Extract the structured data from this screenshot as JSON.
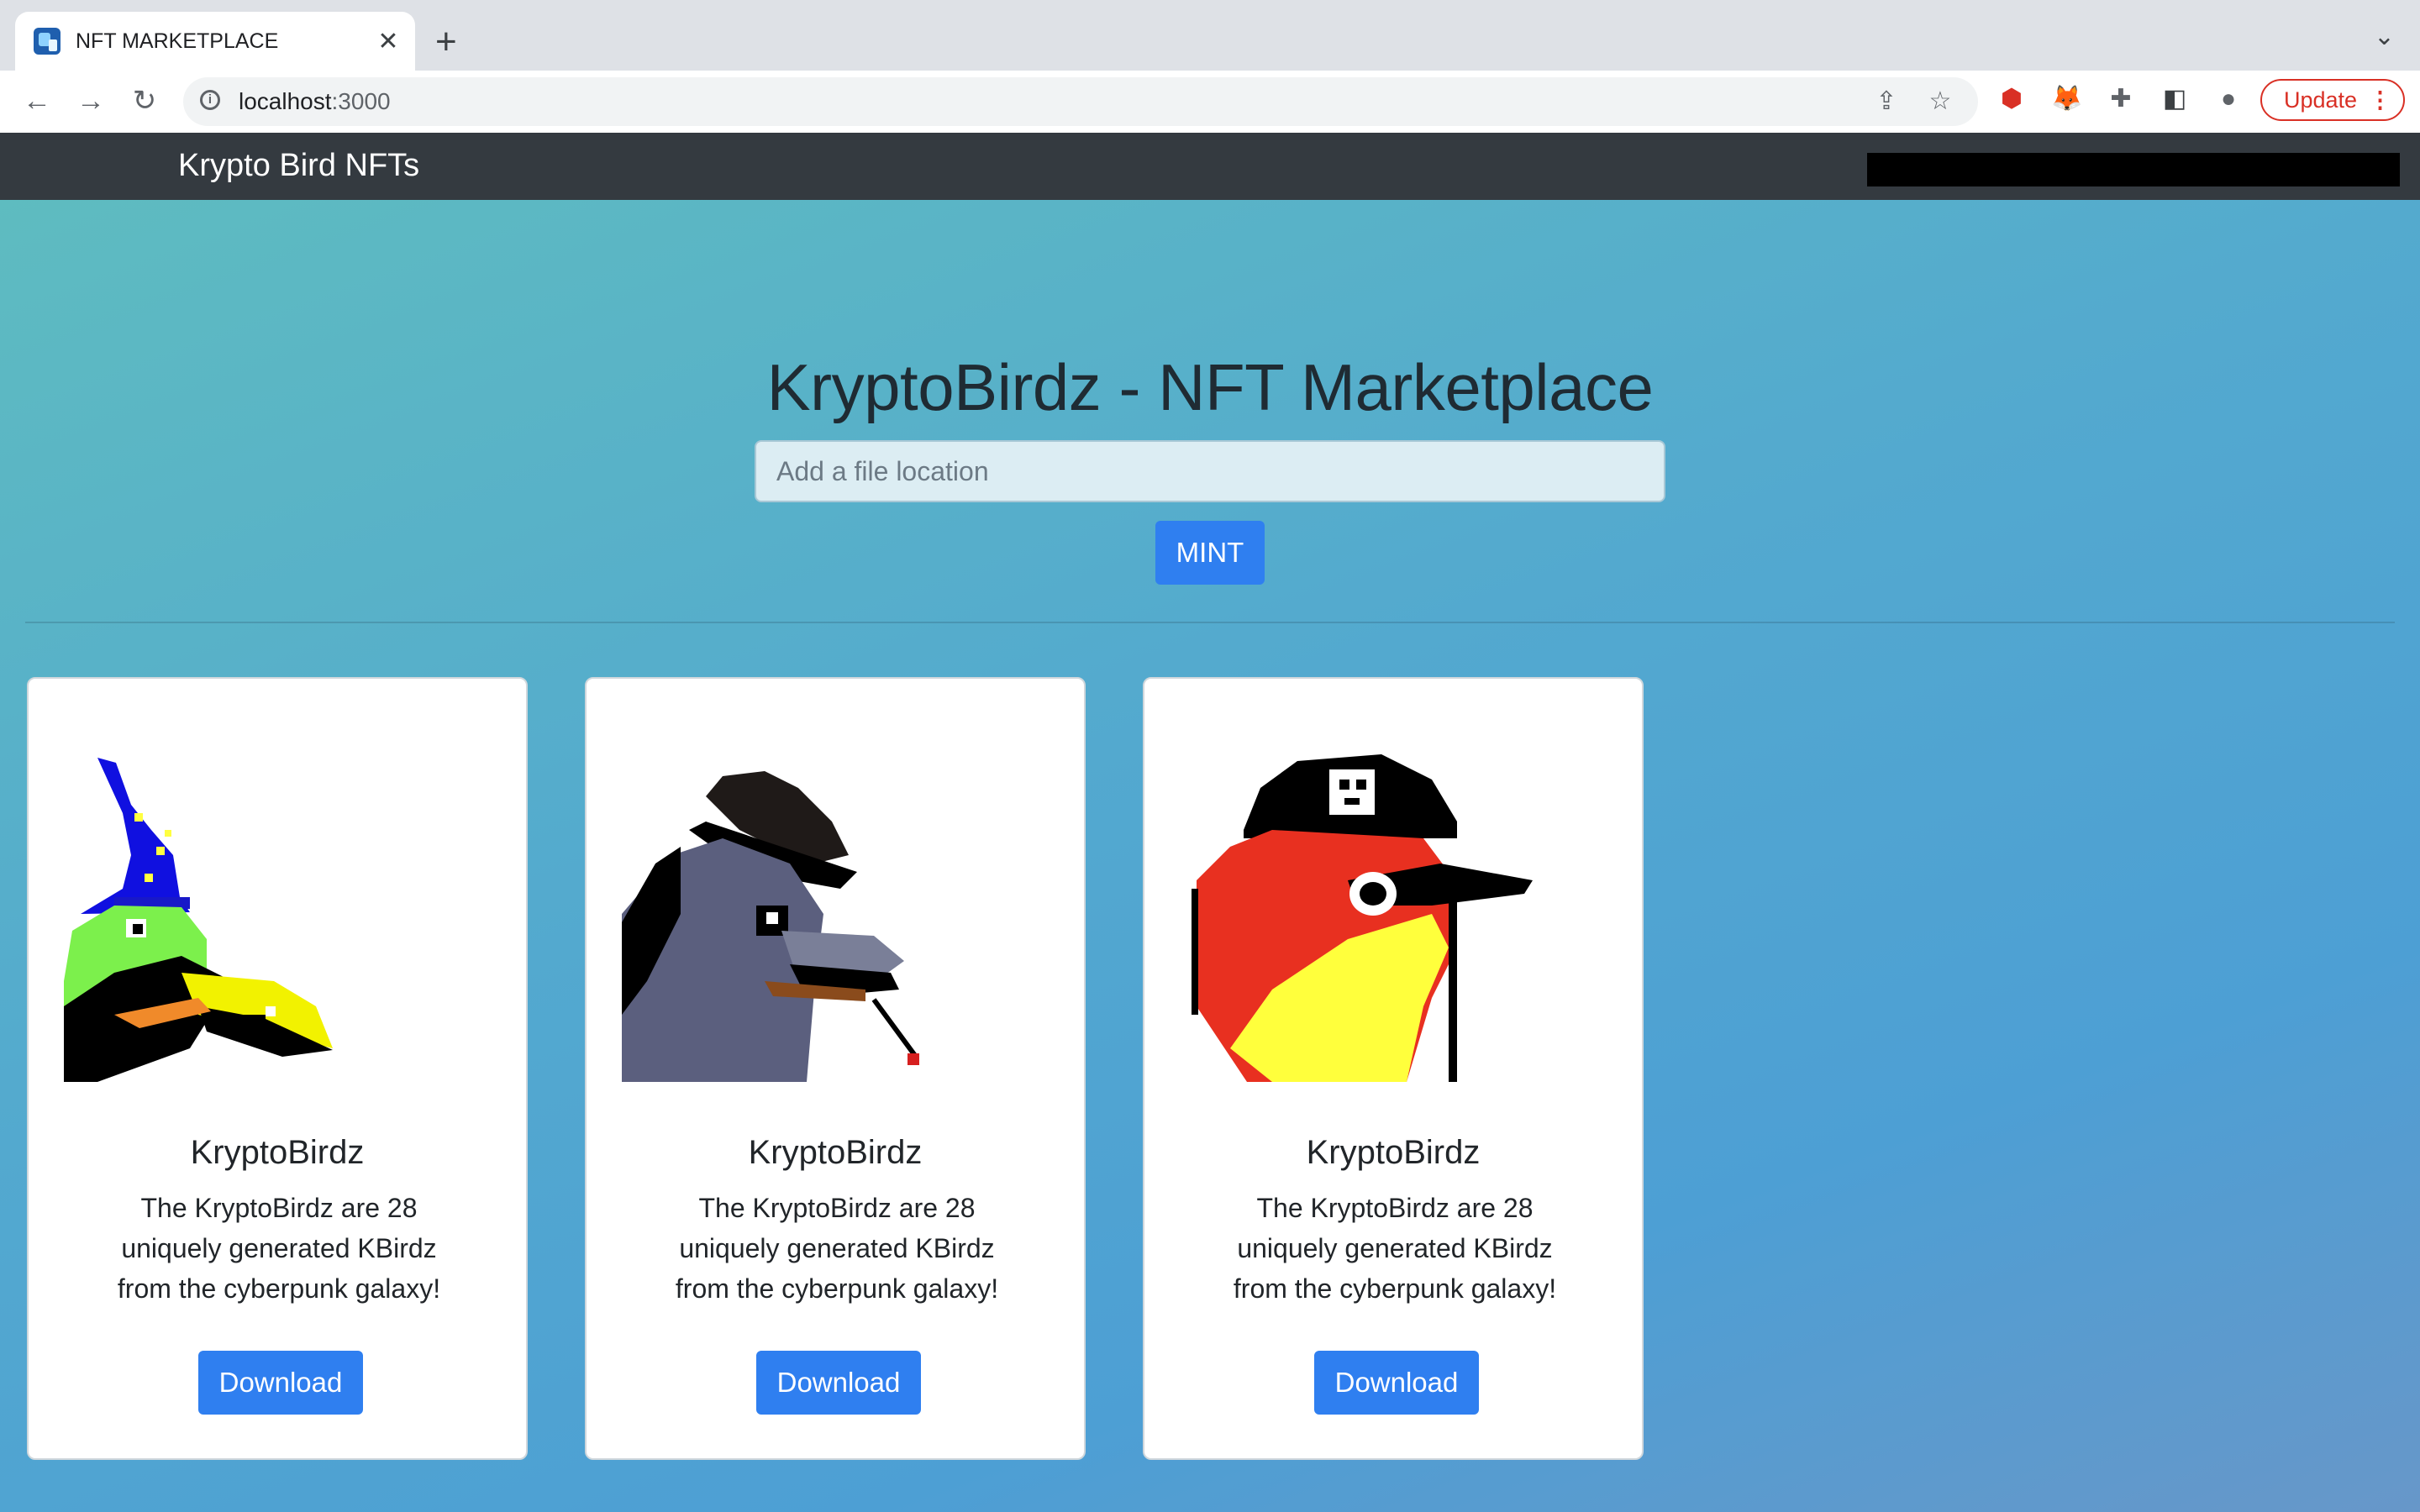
{
  "browser": {
    "tab_title": "NFT MARKETPLACE",
    "url_host": "localhost",
    "url_port": ":3000",
    "update_label": "Update"
  },
  "navbar": {
    "brand": "Krypto Bird NFTs"
  },
  "hero": {
    "title": "KryptoBirdz - NFT Marketplace",
    "input_placeholder": "Add a file location",
    "mint_label": "MINT"
  },
  "cards": [
    {
      "title": "KryptoBirdz",
      "text": "The KryptoBirdz are 28 uniquely generated KBirdz from the cyberpunk galaxy!",
      "button": "Download",
      "image": "wizard-bird"
    },
    {
      "title": "KryptoBirdz",
      "text": "The KryptoBirdz are 28 uniquely generated KBirdz from the cyberpunk galaxy!",
      "button": "Download",
      "image": "gangster-bird"
    },
    {
      "title": "KryptoBirdz",
      "text": "The KryptoBirdz are 28 uniquely generated KBirdz from the cyberpunk galaxy!",
      "button": "Download",
      "image": "pirate-bird"
    }
  ],
  "colors": {
    "navbar_bg": "#343a40",
    "primary_button": "#2f7ff0",
    "update_red": "#d93025"
  }
}
